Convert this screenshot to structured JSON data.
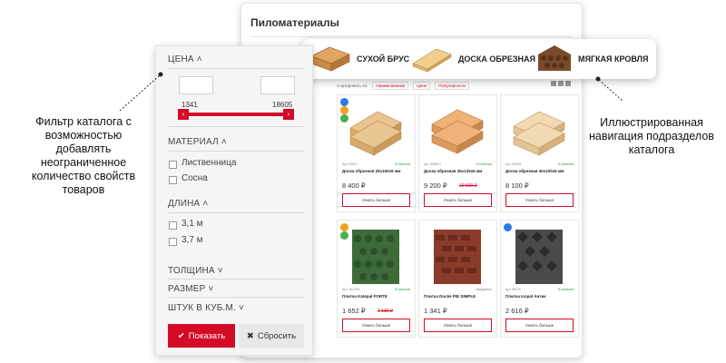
{
  "shop": {
    "title": "Пиломатериалы",
    "sort_label": "Сортировать по:",
    "sort_options": [
      "Наименованию",
      "Цене",
      "Популярности"
    ]
  },
  "categories": [
    {
      "label": "СУХОЙ БРУС",
      "icon": "beam-icon"
    },
    {
      "label": "ДОСКА ОБРЕЗНАЯ",
      "icon": "board-icon"
    },
    {
      "label": "МЯГКАЯ КРОВЛЯ",
      "icon": "roof-tile-icon"
    }
  ],
  "filter": {
    "price_heading": "ЦЕНА",
    "price_min": "1341",
    "price_max": "18605",
    "material_heading": "МАТЕРИАЛ",
    "material_options": [
      "Лиственница",
      "Сосна"
    ],
    "length_heading": "ДЛИНА",
    "length_options": [
      "3,1 м",
      "3,7 м"
    ],
    "thickness_heading": "ТОЛЩИНА",
    "size_heading": "РАЗМЕР",
    "pcs_heading": "ШТУК В КУБ.М.",
    "show_button": "Показать",
    "reset_button": "Сбросить"
  },
  "products": [
    {
      "art": "Арт. 53627",
      "stock": "В наличии",
      "name": "Доска обрезная 25х150х6 мм",
      "price": "8 400 ₽",
      "old_price": "",
      "button": "Узнать больше",
      "image": "lumber-stack"
    },
    {
      "art": "Арт. 456901",
      "stock": "В наличии",
      "name": "Доска обрезная 25х125х6 мм",
      "price": "9 200 ₽",
      "old_price": "10 500 ₽",
      "button": "Узнать больше",
      "image": "lumber-stack"
    },
    {
      "art": "Арт. 53628",
      "stock": "В наличии",
      "name": "Доска обрезная 40х100х6 мм",
      "price": "8 100 ₽",
      "old_price": "",
      "button": "Узнать больше",
      "image": "lumber-stack"
    },
    {
      "art": "Арт. 452195",
      "stock": "В наличии",
      "name": "Плитка Katepal FORTE",
      "price": "1 652 ₽",
      "old_price": "2 130 ₽",
      "button": "Узнать больше",
      "image": "shingle-green"
    },
    {
      "art": "",
      "stock": "Ожидается",
      "name": "Плитка Docke PIE SIMPLE",
      "price": "1 341 ₽",
      "old_price": "",
      "button": "Узнать больше",
      "image": "shingle-red"
    },
    {
      "art": "Арт. 58170",
      "stock": "В наличии",
      "name": "Плитка Icopal Антик",
      "price": "2 616 ₽",
      "old_price": "",
      "button": "Узнать больше",
      "image": "shingle-black"
    }
  ],
  "callouts": {
    "left": "Фильтр каталога с возможностью добавлять неограниченное количество свойств товаров",
    "right": "Иллюстрированная навигация подразделов каталога"
  },
  "colors": {
    "accent": "#d40b26",
    "stock_green": "#2a9c3a"
  }
}
